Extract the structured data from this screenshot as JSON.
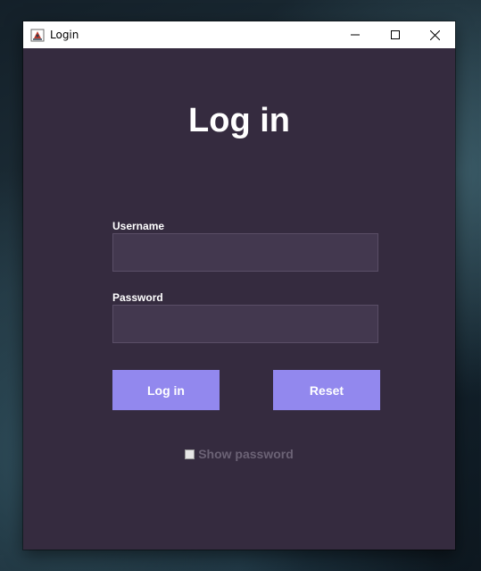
{
  "window": {
    "title": "Login",
    "controls": [
      "minimize",
      "maximize",
      "close"
    ]
  },
  "form": {
    "heading": "Log in",
    "username_label": "Username",
    "username_value": "",
    "password_label": "Password",
    "password_value": "",
    "login_button": "Log in",
    "reset_button": "Reset",
    "show_password_label": "Show password",
    "show_password_checked": false
  },
  "colors": {
    "window_background": "#352b3f",
    "field_background": "#43384f",
    "button_background": "#9288ee",
    "muted_text": "#6b6275"
  }
}
